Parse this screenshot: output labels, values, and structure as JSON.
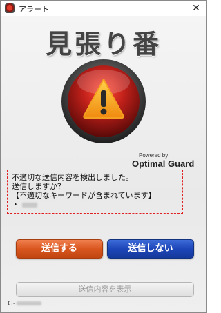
{
  "window": {
    "title": "アラート",
    "close_glyph": "✕"
  },
  "app": {
    "title": "見張り番",
    "emblem_icon": "warning-triangle-icon",
    "powered_by": "Powered by",
    "brand": "Optimal Guard"
  },
  "message": {
    "line1": "不適切な送信内容を検出しました。",
    "line2": "送信しますか？",
    "line3": "【不適切なキーワードが含まれています】",
    "line4_prefix": "・"
  },
  "buttons": {
    "send": "送信する",
    "no_send": "送信しない",
    "show_content": "送信内容を表示"
  },
  "footer": {
    "code_prefix": "G-"
  },
  "colors": {
    "send_button": "#d9561e",
    "no_send_button": "#1d46b8",
    "message_border": "#e02020",
    "emblem_red": "#c0201a",
    "emblem_ring": "#3a3a3a"
  }
}
